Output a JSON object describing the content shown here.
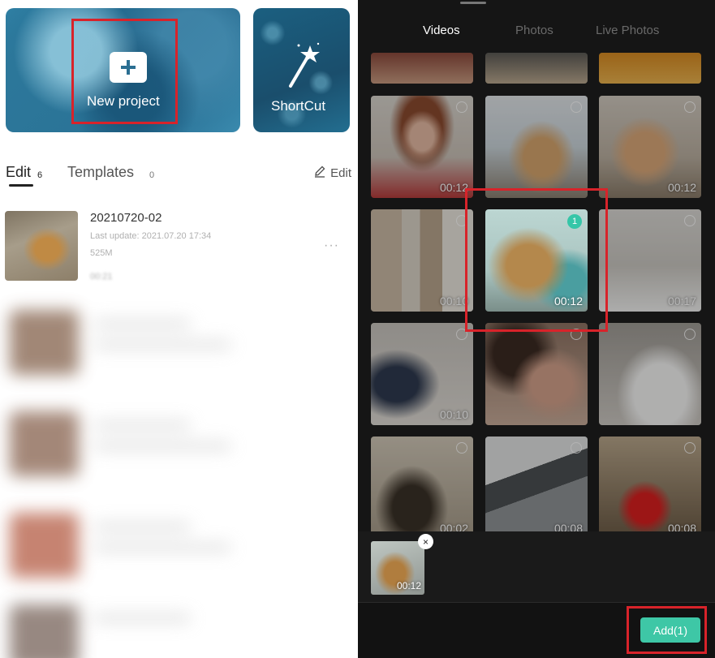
{
  "left_panel": {
    "new_project": {
      "label": "New project"
    },
    "shortcut": {
      "label": "ShortCut"
    },
    "tabs": {
      "edit": {
        "label": "Edit",
        "count": "6"
      },
      "templates": {
        "label": "Templates",
        "count": "0"
      }
    },
    "edit_action": {
      "label": "Edit"
    },
    "projects": [
      {
        "title": "20210720-02",
        "last_update": "Last update: 2021.07.20 17:34",
        "size": "525M",
        "duration": "00:21",
        "more": "···"
      }
    ]
  },
  "right_panel": {
    "tabs": {
      "videos": "Videos",
      "photos": "Photos",
      "live_photos": "Live Photos"
    },
    "grid": [
      {
        "duration": "00:12"
      },
      {
        "duration": "00:12"
      },
      {
        "duration": "00:10"
      },
      {
        "duration": "00:12",
        "selected_index": "1"
      },
      {
        "duration": "00:17"
      },
      {
        "duration": "00:10"
      },
      {
        "duration": "00:02"
      },
      {
        "duration": "00:08"
      },
      {
        "duration": "00:08"
      }
    ],
    "selected": {
      "duration": "00:12",
      "remove": "×"
    },
    "add_button": {
      "label": "Add(1)"
    }
  },
  "colors": {
    "accent": "#3ec7a6",
    "highlight_box": "#d8232a",
    "dark_bg": "#151515"
  }
}
